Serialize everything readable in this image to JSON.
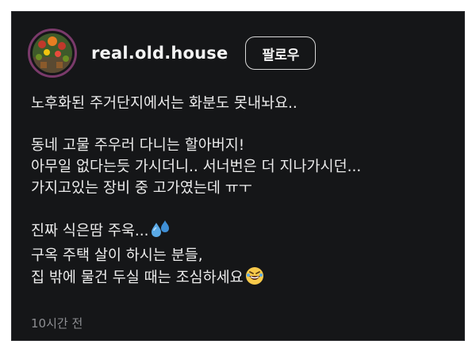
{
  "post": {
    "username": "real.old.house",
    "follow_label": "팔로우",
    "caption_lines": {
      "l1": "노후화된 주거단지에서는 화분도 못내놔요..",
      "l2": "동네 고물 주우러 다니는 할아버지!",
      "l3": "아무일 없다는듯 가시더니.. 서너번은 더 지나가시던...",
      "l4": "가지고있는 장비 중 고가였는데 ㅠㅜ",
      "l5": "진짜 식은땀 주욱...",
      "l6": "구옥 주택 살이 하시는 분들,",
      "l7": "집 밖에 물건 두실 때는 조심하세요"
    },
    "timestamp": "10시간 전"
  },
  "icons": {
    "sweat": "sweat-droplets-icon",
    "laugh": "rolling-laughing-face-icon",
    "avatar": "garden-flowers-avatar"
  },
  "colors": {
    "background": "#151618",
    "text": "#ececec",
    "muted": "#8d8e92",
    "avatar_ring": "#7a3a6a"
  }
}
